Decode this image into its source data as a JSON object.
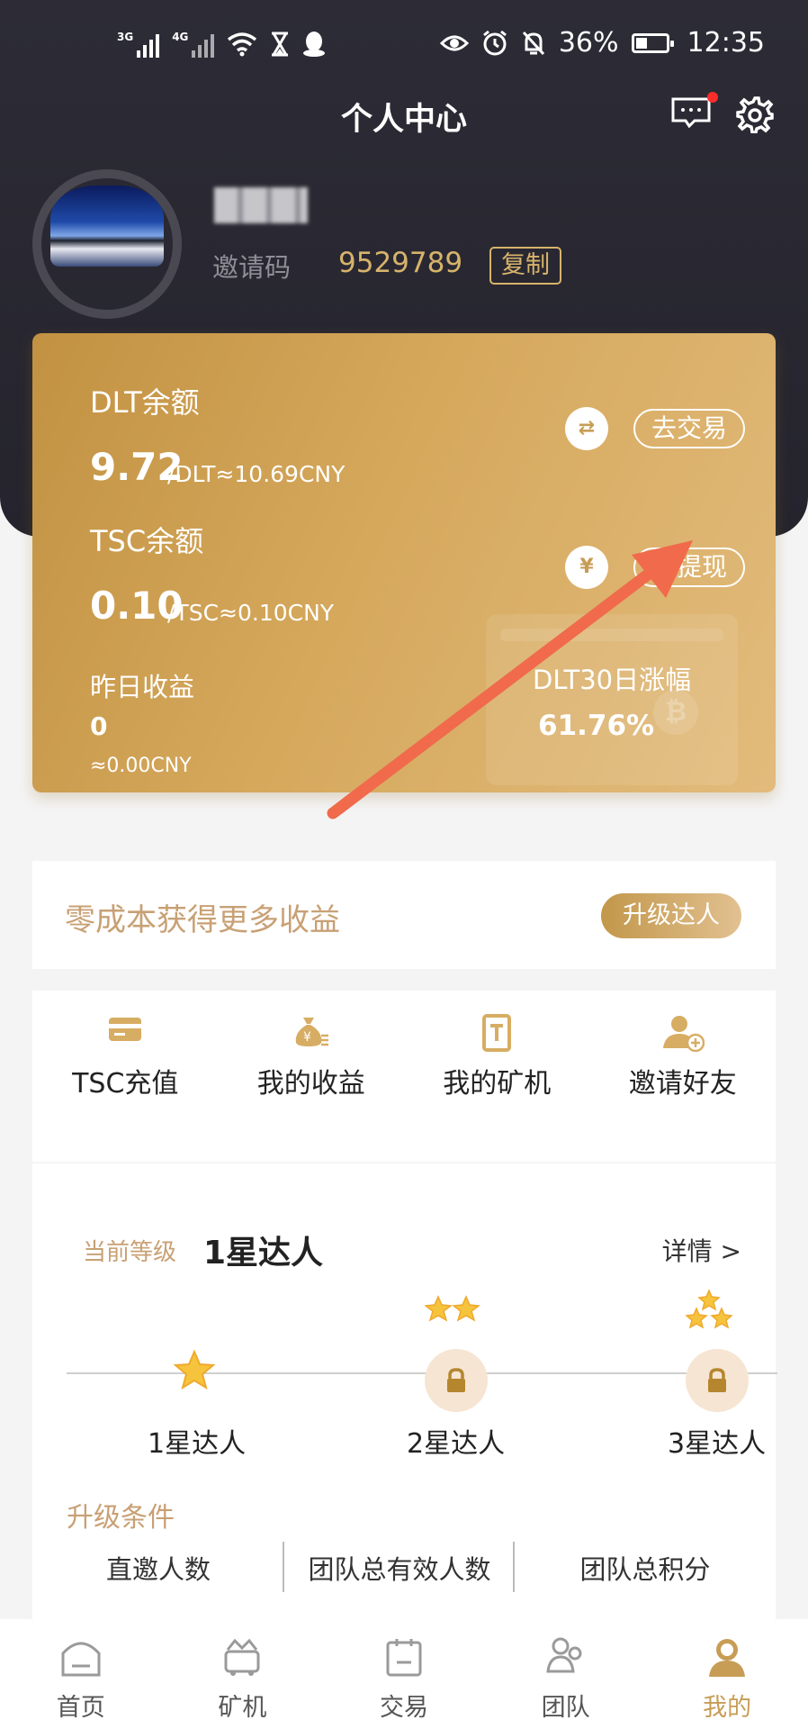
{
  "status_bar": {
    "network1": "3G",
    "network2": "4G",
    "battery": "36%",
    "time": "12:35"
  },
  "header": {
    "title": "个人中心",
    "message_icon": "message-icon",
    "settings_icon": "gear-icon"
  },
  "profile": {
    "invite_label": "邀请码",
    "invite_code": "9529789",
    "copy_label": "复制"
  },
  "balance_card": {
    "dlt_label": "DLT余额",
    "dlt_value": "9.72",
    "dlt_unit": "/DLT≈10.69CNY",
    "trade_button": "去交易",
    "tsc_label": "TSC余额",
    "tsc_value": "0.10",
    "tsc_unit": "/TSC≈0.10CNY",
    "withdraw_button": "去提现",
    "yesterday_label": "昨日收益",
    "yesterday_value": "0",
    "yesterday_cny": "≈0.00CNY",
    "growth_label": "DLT30日涨幅",
    "growth_value": "61.76%",
    "colors": {
      "card_start": "#c29242",
      "card_end": "#e2bb7c"
    }
  },
  "promo": {
    "text": "零成本获得更多收益",
    "button": "升级达人"
  },
  "menu": [
    {
      "label": "TSC充值",
      "icon": "card-icon"
    },
    {
      "label": "我的收益",
      "icon": "money-bag-icon"
    },
    {
      "label": "我的矿机",
      "icon": "machine-icon"
    },
    {
      "label": "邀请好友",
      "icon": "add-user-icon"
    }
  ],
  "level": {
    "current_label": "当前等级",
    "current_value": "1星达人",
    "details": "详情 >",
    "levels": [
      {
        "name": "1星达人",
        "stars": 1,
        "locked": false
      },
      {
        "name": "2星达人",
        "stars": 2,
        "locked": true
      },
      {
        "name": "3星达人",
        "stars": 3,
        "locked": true
      }
    ],
    "conditions_title": "升级条件",
    "conditions": [
      "直邀人数",
      "团队总有效人数",
      "团队总积分"
    ]
  },
  "bottom_nav": [
    {
      "label": "首页",
      "icon": "home-icon",
      "active": false
    },
    {
      "label": "矿机",
      "icon": "miner-icon",
      "active": false
    },
    {
      "label": "交易",
      "icon": "trade-icon",
      "active": false
    },
    {
      "label": "团队",
      "icon": "team-icon",
      "active": false
    },
    {
      "label": "我的",
      "icon": "profile-icon",
      "active": true
    }
  ],
  "colors": {
    "accent": "#c79d55",
    "header_bg": "#2a2932",
    "annotation_arrow": "#f06a4b"
  }
}
